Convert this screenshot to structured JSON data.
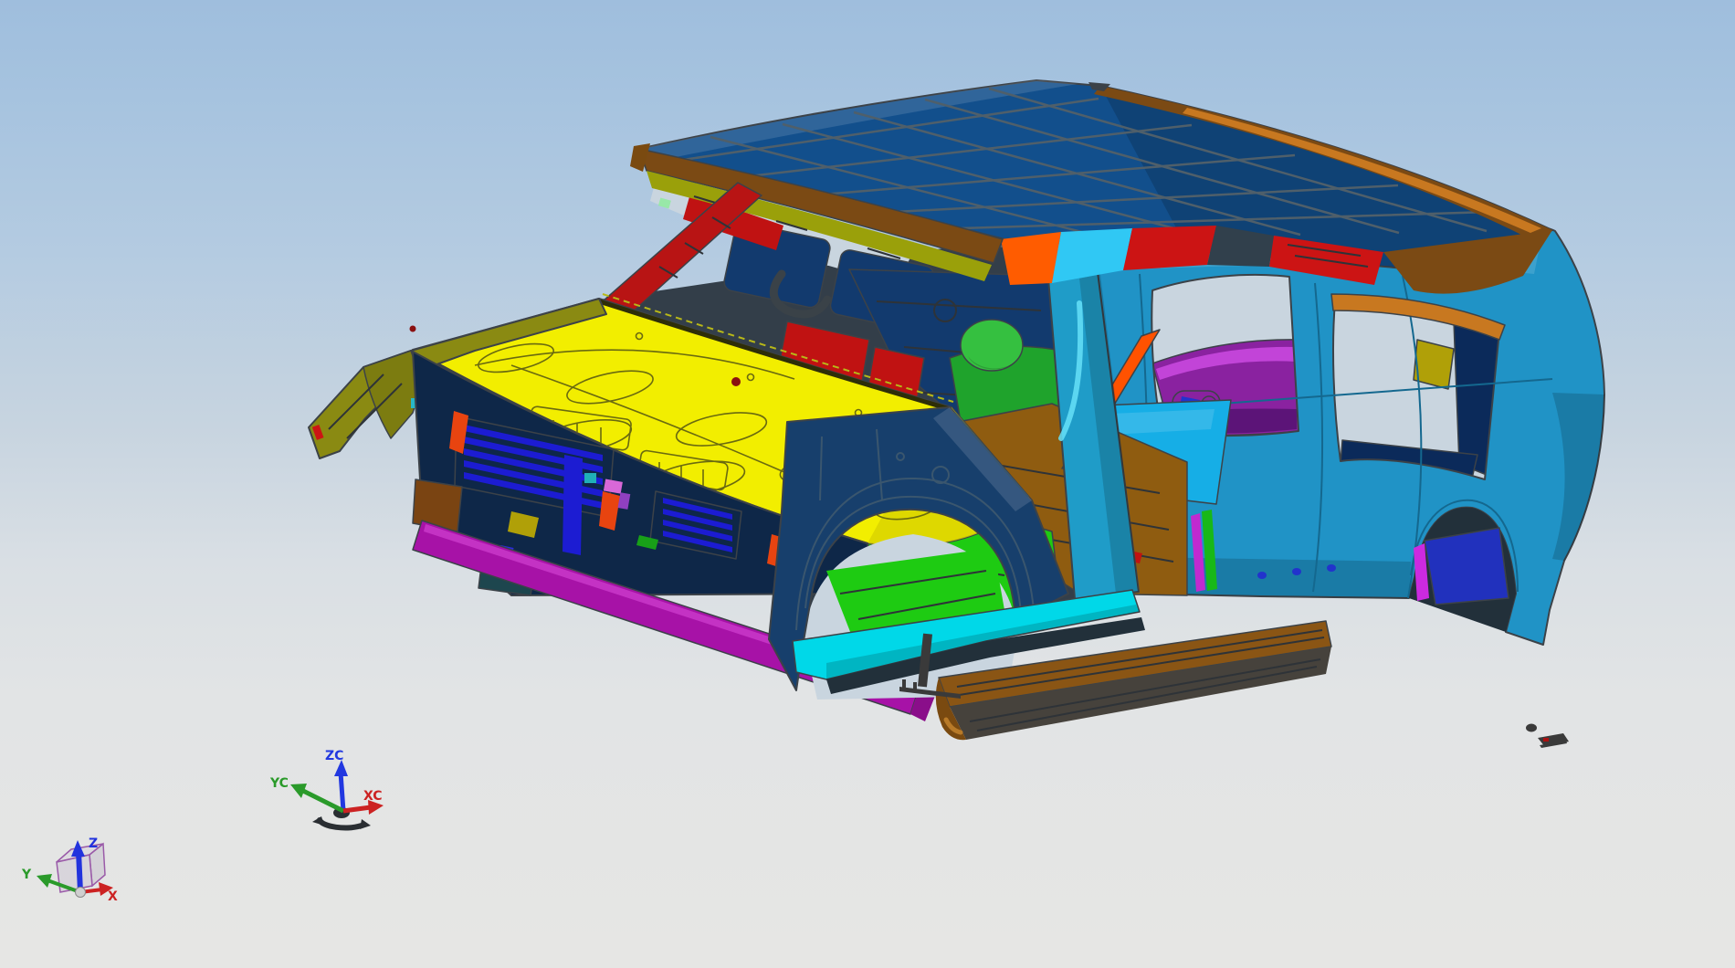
{
  "viewport": {
    "kind": "cad-3d-viewport",
    "background_top": "#9fbedd",
    "background_bottom": "#e6e6e4"
  },
  "axes": {
    "view_triad": {
      "x_label": "X",
      "y_label": "Y",
      "z_label": "Z"
    },
    "wcs_triad": {
      "x_label": "XC",
      "y_label": "YC",
      "z_label": "ZC"
    }
  },
  "colors": {
    "axis_red": "#cc2222",
    "axis_green": "#2a9a2a",
    "axis_blue": "#2233dd",
    "wcs_blue": "#2238e0",
    "cube_purple": "#9a5aa8",
    "glyph_dark": "#2a2e32",
    "sphere_gray": "#cfcfcf",
    "window_bg": "#c9d5df",
    "roof": "#124f8c",
    "roof_trim_brown": "#7b4a14",
    "roof_trim_orange": "#c87820",
    "side_teal": "#2093c6",
    "stripe_orange": "#ff5c00",
    "stripe_cyan": "#30c8f4",
    "stripe_red": "#cc1414",
    "stripe_gap": "#31404c",
    "rear_purple": "#8a22a0",
    "rear_purple_light": "#c244d8",
    "rear_purple_dark": "#5c1478",
    "deep_navy": "#0b2a5a",
    "olive_bracket": "#b0a008",
    "arch_dark": "#22303a",
    "arch_blue": "#2131bd",
    "arch_magenta": "#cc2ae0",
    "dot_blue": "#2233cc",
    "interior_base": "#333e49",
    "visor_navy": "#123a6e",
    "cowl_magenta": "#c828c8",
    "cowl_purple": "#7a0a8a",
    "dash_red": "#c01212",
    "seat_green": "#1fa32c",
    "seat_green_light": "#35c040",
    "floor_cyan": "#16aee6",
    "floor_brown": "#8f5c10",
    "floor_green": "#1ecb12",
    "belt_orange": "#ff5200",
    "bpillar_teal": "#1f9cc8",
    "bpillar_highlight": "#66e0f8",
    "strip_green": "#18b818",
    "strip_magenta": "#c02ad0",
    "header_brown": "#7b4a14",
    "olive_band": "#9aa00a",
    "apillar_red": "#b81414",
    "apillar_brown": "#7a4a14",
    "copper": "#c87830",
    "pale_green": "#98e8a8",
    "hood_yellow": "#f2ee00",
    "hood_yellow_dark": "#d8d200",
    "fender_olive": "#8a8a12",
    "fender_olive_dark": "#7c7c10",
    "lamp_navy": "#0d2444",
    "patch_green": "#118822",
    "patch_teal": "#28b8c8",
    "fender_navy": "#173f6c",
    "grille_navy": "#0e2748",
    "grille_blue": "#1c1cd2",
    "accent_orange": "#e84410",
    "accent_pink": "#d868d8",
    "accent_violet": "#9040c0",
    "accent_dkyellow": "#b0a008",
    "accent_green": "#18a018",
    "accent_teal": "#20b0b8",
    "box_brown": "#7a4412",
    "box_teal": "#1d464e",
    "tab_blue": "#2a2ae0",
    "bumper_magenta": "#a712a7",
    "bumper_magenta_dark": "#8a0e8a",
    "sill_cyan": "#00d8e8",
    "sill_cyan_dark": "#0e8cb0",
    "board_brown": "#8a5514",
    "board_side": "#46423c",
    "board_cap": "#7a4a10",
    "debris": "#3a3a3a",
    "debris_red": "#aa1010",
    "outline": "#3c4248"
  },
  "parts": [
    {
      "name": "roof-panel",
      "color_ref": "roof"
    },
    {
      "name": "hood-panel",
      "color_ref": "hood_yellow"
    },
    {
      "name": "body-side-rear",
      "color_ref": "side_teal"
    },
    {
      "name": "front-fender",
      "color_ref": "fender_navy"
    },
    {
      "name": "left-fender",
      "color_ref": "fender_olive"
    },
    {
      "name": "front-floor",
      "color_ref": "floor_green"
    },
    {
      "name": "mid-floor",
      "color_ref": "floor_brown"
    },
    {
      "name": "running-board",
      "color_ref": "board_brown"
    },
    {
      "name": "bumper-beam",
      "color_ref": "bumper_magenta"
    },
    {
      "name": "cowl-panel",
      "color_ref": "cowl_magenta"
    },
    {
      "name": "a-pillar-inner",
      "color_ref": "apillar_red"
    },
    {
      "name": "seat-frame",
      "color_ref": "seat_green"
    }
  ]
}
